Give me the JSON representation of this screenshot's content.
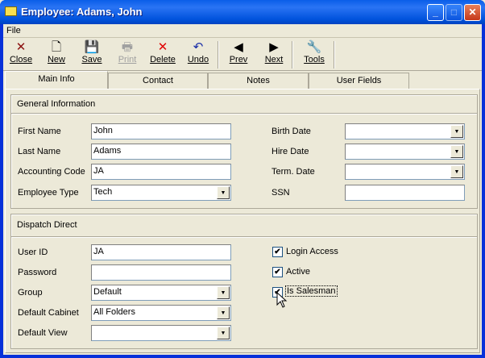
{
  "window": {
    "title": "Employee: Adams, John",
    "minimize": "_",
    "maximize": "□",
    "close": "✕"
  },
  "menu": {
    "file": "File"
  },
  "toolbar": [
    {
      "label": "Close",
      "icon": "✕",
      "color": "#8b1010",
      "enabled": true
    },
    {
      "label": "New",
      "icon": "🗋",
      "color": "#000000",
      "enabled": true
    },
    {
      "label": "Save",
      "icon": "💾",
      "color": "#005a5a",
      "enabled": true
    },
    {
      "label": "Print",
      "icon": "🖶",
      "color": "#a0a0a0",
      "enabled": false
    },
    {
      "label": "Delete",
      "icon": "✕",
      "color": "#e00000",
      "enabled": true
    },
    {
      "label": "Undo",
      "icon": "↶",
      "color": "#1a2ea8",
      "enabled": true
    },
    {
      "label": "Prev",
      "icon": "◀",
      "color": "#000000",
      "enabled": true
    },
    {
      "label": "Next",
      "icon": "▶",
      "color": "#000000",
      "enabled": true
    },
    {
      "label": "Tools",
      "icon": "🔧",
      "color": "#606060",
      "enabled": true
    }
  ],
  "tabs": [
    "Main Info",
    "Contact",
    "Notes",
    "User Fields"
  ],
  "general": {
    "title": "General Information",
    "first_name": {
      "label": "First Name",
      "value": "John"
    },
    "last_name": {
      "label": "Last Name",
      "value": "Adams"
    },
    "accounting_code": {
      "label": "Accounting Code",
      "value": "JA"
    },
    "employee_type": {
      "label": "Employee Type",
      "value": "Tech"
    },
    "birth_date": {
      "label": "Birth Date",
      "value": ""
    },
    "hire_date": {
      "label": "Hire Date",
      "value": ""
    },
    "term_date": {
      "label": "Term. Date",
      "value": ""
    },
    "ssn": {
      "label": "SSN",
      "value": ""
    }
  },
  "dispatch": {
    "title": "Dispatch Direct",
    "user_id": {
      "label": "User ID",
      "value": "JA"
    },
    "password": {
      "label": "Password",
      "value": ""
    },
    "group": {
      "label": "Group",
      "value": "Default"
    },
    "default_cabinet": {
      "label": "Default Cabinet",
      "value": "All Folders"
    },
    "default_view": {
      "label": "Default View",
      "value": ""
    },
    "login_access": {
      "label": "Login Access",
      "checked": true
    },
    "active": {
      "label": "Active",
      "checked": true
    },
    "is_salesman": {
      "label": "Is Salesman",
      "checked": true
    }
  }
}
